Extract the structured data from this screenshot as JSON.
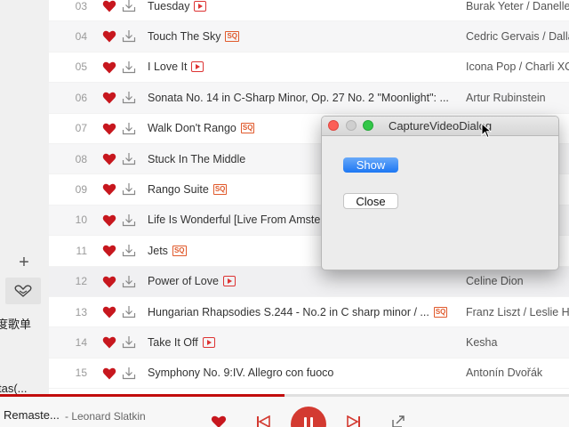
{
  "sidebar": {
    "add_symbol": "+",
    "label_playlist": "度歌单",
    "label_bottom": "tas(..."
  },
  "songs": [
    {
      "num": "03",
      "title": "Tuesday",
      "tag": "mv",
      "artist": "Burak Yeter / Danelle"
    },
    {
      "num": "04",
      "title": "Touch The Sky",
      "tag": "sq",
      "artist": "Cedric Gervais / Dalla"
    },
    {
      "num": "05",
      "title": "I Love It",
      "tag": "mv",
      "artist": "Icona Pop / Charli XC"
    },
    {
      "num": "06",
      "title": "Sonata No. 14 in C-Sharp Minor, Op. 27 No. 2 \"Moonlight\": ...",
      "tag": "",
      "artist": "Artur Rubinstein"
    },
    {
      "num": "07",
      "title": "Walk Don't Rango",
      "tag": "sq",
      "artist": ""
    },
    {
      "num": "08",
      "title": "Stuck In The Middle",
      "tag": "",
      "artist": ""
    },
    {
      "num": "09",
      "title": "Rango Suite",
      "tag": "sq",
      "artist": ""
    },
    {
      "num": "10",
      "title": "Life Is Wonderful [Live From Amster",
      "tag": "",
      "artist": ""
    },
    {
      "num": "11",
      "title": "Jets",
      "tag": "sq",
      "artist": ""
    },
    {
      "num": "12",
      "title": "Power of Love",
      "tag": "mv",
      "artist": "Celine Dion"
    },
    {
      "num": "13",
      "title": "Hungarian Rhapsodies S.244 - No.2 in C sharp minor / ...",
      "tag": "sq",
      "artist": "Franz Liszt / Leslie Ho"
    },
    {
      "num": "14",
      "title": "Take It Off",
      "tag": "mv",
      "artist": "Kesha"
    },
    {
      "num": "15",
      "title": "Symphony No. 9:IV. Allegro con fuoco",
      "tag": "",
      "artist": "Antonín Dvořák"
    }
  ],
  "tags": {
    "sq": "SQ"
  },
  "player": {
    "now_title": "Remaste...",
    "now_artist": "- Leonard Slatkin",
    "progress": 0.5
  },
  "dialog": {
    "title": "CaptureVideoDialog",
    "show_label": "Show",
    "close_label": "Close"
  },
  "colors": {
    "accent": "#c20c0c",
    "heart": "#c7171e",
    "mac_blue": "#1d77f3"
  }
}
